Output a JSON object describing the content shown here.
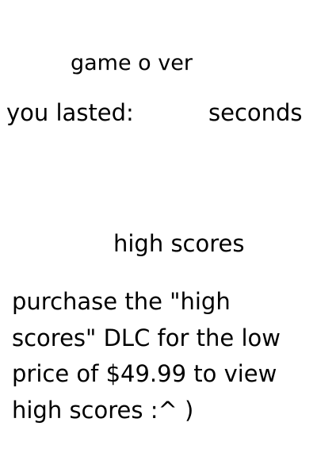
{
  "game_over": {
    "title": "game o ver",
    "survival": {
      "label": "you lasted:",
      "value": "",
      "unit": "seconds"
    }
  },
  "high_scores": {
    "heading": "high scores",
    "message": "purchase the \"high scores\" DLC for the low price of $49.99 to view high scores :^ )"
  },
  "colors": {
    "background": "#ffffff",
    "text": "#000000"
  }
}
